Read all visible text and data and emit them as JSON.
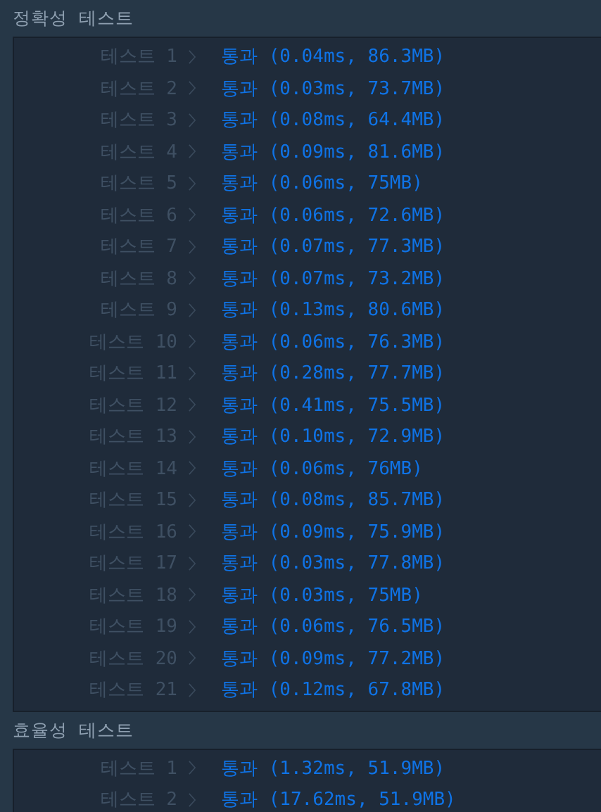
{
  "sections": [
    {
      "title": "정확성  테스트",
      "tests": [
        {
          "label": "테스트 1",
          "result": "통과 (0.04ms, 86.3MB)"
        },
        {
          "label": "테스트 2",
          "result": "통과 (0.03ms, 73.7MB)"
        },
        {
          "label": "테스트 3",
          "result": "통과 (0.08ms, 64.4MB)"
        },
        {
          "label": "테스트 4",
          "result": "통과 (0.09ms, 81.6MB)"
        },
        {
          "label": "테스트 5",
          "result": "통과 (0.06ms, 75MB)"
        },
        {
          "label": "테스트 6",
          "result": "통과 (0.06ms, 72.6MB)"
        },
        {
          "label": "테스트 7",
          "result": "통과 (0.07ms, 77.3MB)"
        },
        {
          "label": "테스트 8",
          "result": "통과 (0.07ms, 73.2MB)"
        },
        {
          "label": "테스트 9",
          "result": "통과 (0.13ms, 80.6MB)"
        },
        {
          "label": "테스트 10",
          "result": "통과 (0.06ms, 76.3MB)"
        },
        {
          "label": "테스트 11",
          "result": "통과 (0.28ms, 77.7MB)"
        },
        {
          "label": "테스트 12",
          "result": "통과 (0.41ms, 75.5MB)"
        },
        {
          "label": "테스트 13",
          "result": "통과 (0.10ms, 72.9MB)"
        },
        {
          "label": "테스트 14",
          "result": "통과 (0.06ms, 76MB)"
        },
        {
          "label": "테스트 15",
          "result": "통과 (0.08ms, 85.7MB)"
        },
        {
          "label": "테스트 16",
          "result": "통과 (0.09ms, 75.9MB)"
        },
        {
          "label": "테스트 17",
          "result": "통과 (0.03ms, 77.8MB)"
        },
        {
          "label": "테스트 18",
          "result": "통과 (0.03ms, 75MB)"
        },
        {
          "label": "테스트 19",
          "result": "통과 (0.06ms, 76.5MB)"
        },
        {
          "label": "테스트 20",
          "result": "통과 (0.09ms, 77.2MB)"
        },
        {
          "label": "테스트 21",
          "result": "통과 (0.12ms, 67.8MB)"
        }
      ]
    },
    {
      "title": "효율성  테스트",
      "tests": [
        {
          "label": "테스트 1",
          "result": "통과 (1.32ms, 51.9MB)"
        },
        {
          "label": "테스트 2",
          "result": "통과 (17.62ms, 51.9MB)"
        }
      ]
    }
  ]
}
